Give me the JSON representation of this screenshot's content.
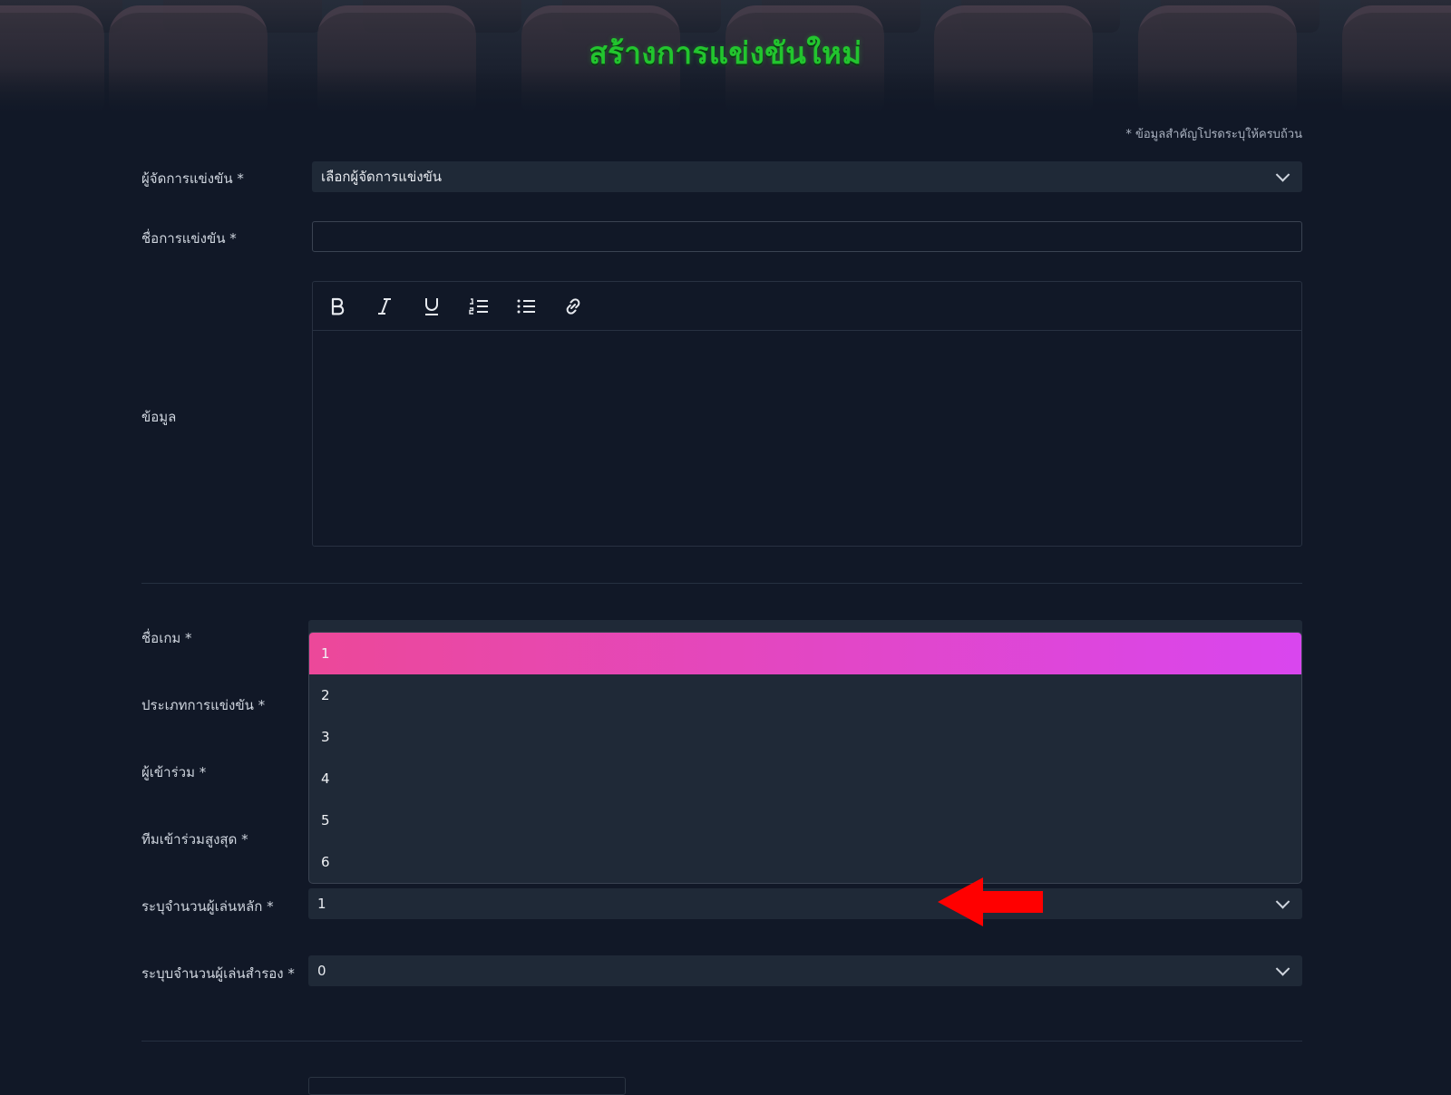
{
  "page": {
    "title": "สร้างการแข่งขันใหม่",
    "required_note": "* ข้อมูลสำคัญโปรดระบุให้ครบถ้วน"
  },
  "form": {
    "organizer": {
      "label": "ผู้จัดการแข่งขัน *",
      "value": "เลือกผู้จัดการแข่งขัน"
    },
    "name": {
      "label": "ชื่อการแข่งขัน *",
      "value": ""
    },
    "info": {
      "label": "ข้อมูล"
    },
    "editor_toolbar": [
      "bold-icon",
      "italic-icon",
      "underline-icon",
      "ordered-list-icon",
      "bullet-list-icon",
      "link-icon"
    ],
    "game": {
      "label": "ชื่อเกม *"
    },
    "type": {
      "label": "ประเภทการแข่งขัน *"
    },
    "participants": {
      "label": "ผู้เข้าร่วม *"
    },
    "max_teams": {
      "label": "ทีมเข้าร่วมสูงสุด *"
    },
    "main_players": {
      "label": "ระบุจำนวนผู้เล่นหลัก *",
      "value": "1"
    },
    "sub_players": {
      "label": "ระบุบจำนวนผู้เล่นสำรอง *",
      "value": "0"
    }
  },
  "dropdown": {
    "options": [
      "1",
      "2",
      "3",
      "4",
      "5",
      "6"
    ],
    "selected": "1"
  },
  "colors": {
    "title_green": "#22c52e",
    "selected_gradient_start": "#ec4899",
    "selected_gradient_end": "#d946ef",
    "annotation_arrow": "#ff0000"
  }
}
